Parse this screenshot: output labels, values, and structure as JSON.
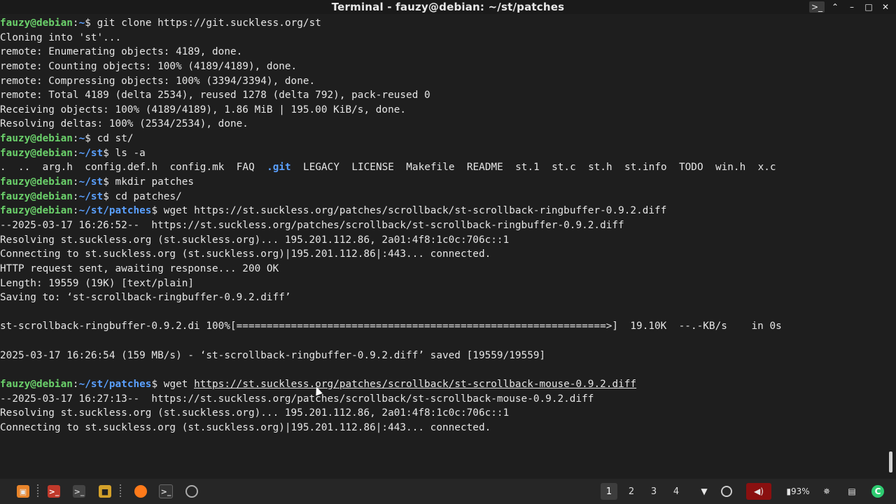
{
  "window": {
    "title": "Terminal - fauzy@debian: ~/st/patches",
    "controls": [
      "app-icon",
      "minimize",
      "maximize",
      "close"
    ]
  },
  "terminal": {
    "lines": [
      {
        "user": "fauzy@debian",
        "path": "~",
        "cmd": " git clone https://git.suckless.org/st"
      },
      {
        "text": "Cloning into 'st'..."
      },
      {
        "text": "remote: Enumerating objects: 4189, done."
      },
      {
        "text": "remote: Counting objects: 100% (4189/4189), done."
      },
      {
        "text": "remote: Compressing objects: 100% (3394/3394), done."
      },
      {
        "text": "remote: Total 4189 (delta 2534), reused 1278 (delta 792), pack-reused 0"
      },
      {
        "text": "Receiving objects: 100% (4189/4189), 1.86 MiB | 195.00 KiB/s, done."
      },
      {
        "text": "Resolving deltas: 100% (2534/2534), done."
      },
      {
        "user": "fauzy@debian",
        "path": "~",
        "cmd": " cd st/"
      },
      {
        "user": "fauzy@debian",
        "path": "~/st",
        "cmd": " ls -a"
      },
      {
        "ls": true
      },
      {
        "user": "fauzy@debian",
        "path": "~/st",
        "cmd": " mkdir patches"
      },
      {
        "user": "fauzy@debian",
        "path": "~/st",
        "cmd": " cd patches/"
      },
      {
        "user": "fauzy@debian",
        "path": "~/st/patches",
        "cmd": " wget https://st.suckless.org/patches/scrollback/st-scrollback-ringbuffer-0.9.2.diff"
      },
      {
        "text": "--2025-03-17 16:26:52--  https://st.suckless.org/patches/scrollback/st-scrollback-ringbuffer-0.9.2.diff"
      },
      {
        "text": "Resolving st.suckless.org (st.suckless.org)... 195.201.112.86, 2a01:4f8:1c0c:706c::1"
      },
      {
        "text": "Connecting to st.suckless.org (st.suckless.org)|195.201.112.86|:443... connected."
      },
      {
        "text": "HTTP request sent, awaiting response... 200 OK"
      },
      {
        "text": "Length: 19559 (19K) [text/plain]"
      },
      {
        "text": "Saving to: ‘st-scrollback-ringbuffer-0.9.2.diff’"
      },
      {
        "text": ""
      },
      {
        "text": "st-scrollback-ringbuffer-0.9.2.di 100%[=============================================================>]  19.10K  --.-KB/s    in 0s"
      },
      {
        "text": ""
      },
      {
        "text": "2025-03-17 16:26:54 (159 MB/s) - ‘st-scrollback-ringbuffer-0.9.2.diff’ saved [19559/19559]"
      },
      {
        "text": ""
      },
      {
        "user": "fauzy@debian",
        "path": "~/st/patches",
        "cmd": " wget ",
        "link": "https://st.suckless.org/patches/scrollback/st-scrollback-mouse-0.9.2.diff"
      },
      {
        "text": "--2025-03-17 16:27:13--  https://st.suckless.org/patches/scrollback/st-scrollback-mouse-0.9.2.diff"
      },
      {
        "text": "Resolving st.suckless.org (st.suckless.org)... 195.201.112.86, 2a01:4f8:1c0c:706c::1"
      },
      {
        "text": "Connecting to st.suckless.org (st.suckless.org)|195.201.112.86|:443... connected."
      }
    ],
    "ls_entries": [
      {
        "name": ".",
        "dir": false
      },
      {
        "name": "..",
        "dir": false
      },
      {
        "name": "arg.h",
        "dir": false
      },
      {
        "name": "config.def.h",
        "dir": false
      },
      {
        "name": "config.mk",
        "dir": false
      },
      {
        "name": "FAQ",
        "dir": false
      },
      {
        "name": ".git",
        "dir": true
      },
      {
        "name": "LEGACY",
        "dir": false
      },
      {
        "name": "LICENSE",
        "dir": false
      },
      {
        "name": "Makefile",
        "dir": false
      },
      {
        "name": "README",
        "dir": false
      },
      {
        "name": "st.1",
        "dir": false
      },
      {
        "name": "st.c",
        "dir": false
      },
      {
        "name": "st.h",
        "dir": false
      },
      {
        "name": "st.info",
        "dir": false
      },
      {
        "name": "TODO",
        "dir": false
      },
      {
        "name": "win.h",
        "dir": false
      },
      {
        "name": "x.c",
        "dir": false
      }
    ],
    "prompt_symbol": "$"
  },
  "taskbar": {
    "launchers": [
      {
        "name": "menu-icon",
        "color": "#e8842a"
      },
      {
        "name": "terminal-icon",
        "color": "#c0392b"
      },
      {
        "name": "terminal-alt-icon",
        "color": "#444444"
      },
      {
        "name": "files-icon",
        "color": "#d4a12a"
      },
      {
        "name": "firefox-icon",
        "color": "#ff7a1a"
      },
      {
        "name": "terminal-window-icon",
        "color": "#333333"
      },
      {
        "name": "settings-icon",
        "color": "#333333"
      }
    ],
    "workspaces": [
      "1",
      "2",
      "3",
      "4"
    ],
    "active_workspace": "1",
    "battery": "93%"
  },
  "colors": {
    "background": "#1e1e1e",
    "user": "#6bd16b",
    "path": "#5aa0ff",
    "text": "#e6e6e6"
  }
}
